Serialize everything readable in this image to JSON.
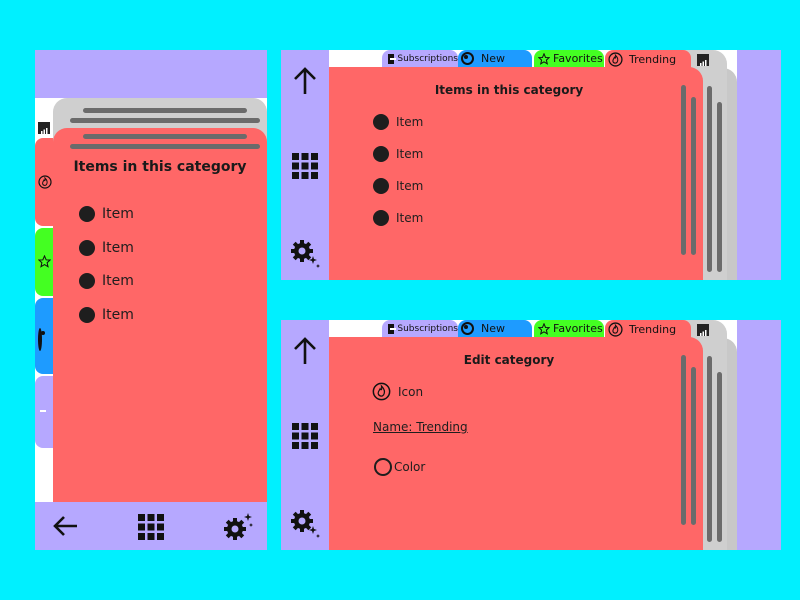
{
  "colors": {
    "background": "#00f0ff",
    "rail": "#b6a8ff",
    "card": "#ff6767",
    "tab_subscriptions": "#b6a8ff",
    "tab_new": "#1e9bff",
    "tab_favorites": "#44ff22",
    "tab_trending": "#ff6767"
  },
  "tabs": [
    {
      "label": "Subscriptions",
      "icon": "subscriptions-icon"
    },
    {
      "label": "New",
      "icon": "radio-icon"
    },
    {
      "label": "Favorites",
      "icon": "star-icon"
    },
    {
      "label": "Trending",
      "icon": "trending-icon"
    }
  ],
  "portrait": {
    "title": "Items in this category",
    "items": [
      "Item",
      "Item",
      "Item",
      "Item"
    ],
    "bottom_nav": [
      "back-arrow-icon",
      "grid-icon",
      "settings-icon"
    ]
  },
  "landscape_list": {
    "title": "Items in this category",
    "items": [
      "Item",
      "Item",
      "Item",
      "Item"
    ],
    "rail": [
      "up-arrow-icon",
      "grid-icon",
      "settings-icon"
    ]
  },
  "landscape_edit": {
    "title": "Edit category",
    "icon_label": "Icon",
    "name_label": "Name: Trending",
    "color_label": "Color",
    "rail": [
      "up-arrow-icon",
      "grid-icon",
      "settings-icon"
    ]
  }
}
